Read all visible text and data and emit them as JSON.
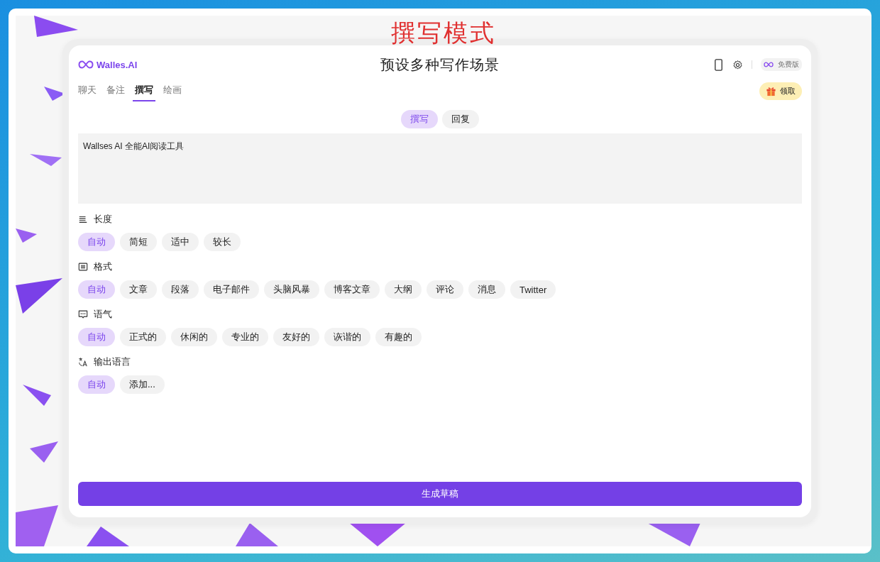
{
  "overlay": {
    "title": "撰写模式"
  },
  "header": {
    "logo": "Walles.AI",
    "subtitle": "预设多种写作场景",
    "plan": "免费版",
    "gift": "领取"
  },
  "tabs": [
    {
      "label": "聊天",
      "selected": false
    },
    {
      "label": "备注",
      "selected": false
    },
    {
      "label": "撰写",
      "selected": true
    },
    {
      "label": "绘画",
      "selected": false
    }
  ],
  "mode_tabs": [
    {
      "label": "撰写",
      "selected": true
    },
    {
      "label": "回复",
      "selected": false
    }
  ],
  "editor": {
    "value": "Wallses AI 全能AI阅读工具"
  },
  "sections": [
    {
      "kind": "length",
      "label": "长度",
      "options": [
        {
          "label": "自动",
          "selected": true
        },
        {
          "label": "简短",
          "selected": false
        },
        {
          "label": "适中",
          "selected": false
        },
        {
          "label": "较长",
          "selected": false
        }
      ]
    },
    {
      "kind": "format",
      "label": "格式",
      "options": [
        {
          "label": "自动",
          "selected": true
        },
        {
          "label": "文章",
          "selected": false
        },
        {
          "label": "段落",
          "selected": false
        },
        {
          "label": "电子邮件",
          "selected": false
        },
        {
          "label": "头脑风暴",
          "selected": false
        },
        {
          "label": "博客文章",
          "selected": false
        },
        {
          "label": "大纲",
          "selected": false
        },
        {
          "label": "评论",
          "selected": false
        },
        {
          "label": "消息",
          "selected": false
        },
        {
          "label": "Twitter",
          "selected": false
        }
      ]
    },
    {
      "kind": "tone",
      "label": "语气",
      "options": [
        {
          "label": "自动",
          "selected": true
        },
        {
          "label": "正式的",
          "selected": false
        },
        {
          "label": "休闲的",
          "selected": false
        },
        {
          "label": "专业的",
          "selected": false
        },
        {
          "label": "友好的",
          "selected": false
        },
        {
          "label": "诙谐的",
          "selected": false
        },
        {
          "label": "有趣的",
          "selected": false
        }
      ]
    },
    {
      "kind": "language",
      "label": "输出语言",
      "options": [
        {
          "label": "自动",
          "selected": true
        },
        {
          "label": "添加...",
          "selected": false
        }
      ]
    }
  ],
  "generate_button": "生成草稿"
}
